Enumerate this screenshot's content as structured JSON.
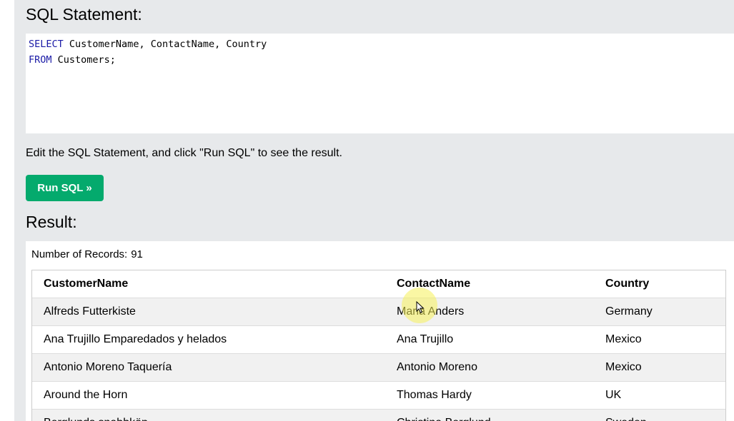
{
  "sql_section": {
    "heading": "SQL Statement:",
    "code": {
      "line1_keyword": "SELECT",
      "line1_rest": " CustomerName, ContactName, Country",
      "line2_keyword": "FROM",
      "line2_rest": " Customers;"
    },
    "hint": "Edit the SQL Statement, and click \"Run SQL\" to see the result.",
    "run_button_label": "Run SQL »"
  },
  "result_section": {
    "heading": "Result:",
    "records_label": "Number of Records:",
    "records_count": "91",
    "columns": [
      "CustomerName",
      "ContactName",
      "Country"
    ],
    "rows": [
      [
        "Alfreds Futterkiste",
        "Maria Anders",
        "Germany"
      ],
      [
        "Ana Trujillo Emparedados y helados",
        "Ana Trujillo",
        "Mexico"
      ],
      [
        "Antonio Moreno Taquería",
        "Antonio Moreno",
        "Mexico"
      ],
      [
        "Around the Horn",
        "Thomas Hardy",
        "UK"
      ],
      [
        "Berglunds snabbköp",
        "Christina Berglund",
        "Sweden"
      ]
    ]
  },
  "colors": {
    "panel_bg": "#e7e9eb",
    "button_bg": "#04aa6d",
    "keyword": "#1a1aa6",
    "row_alt": "#f1f1f1",
    "cursor_highlight": "#f6f05a"
  },
  "icons": {
    "cursor": "mouse-pointer-icon"
  }
}
